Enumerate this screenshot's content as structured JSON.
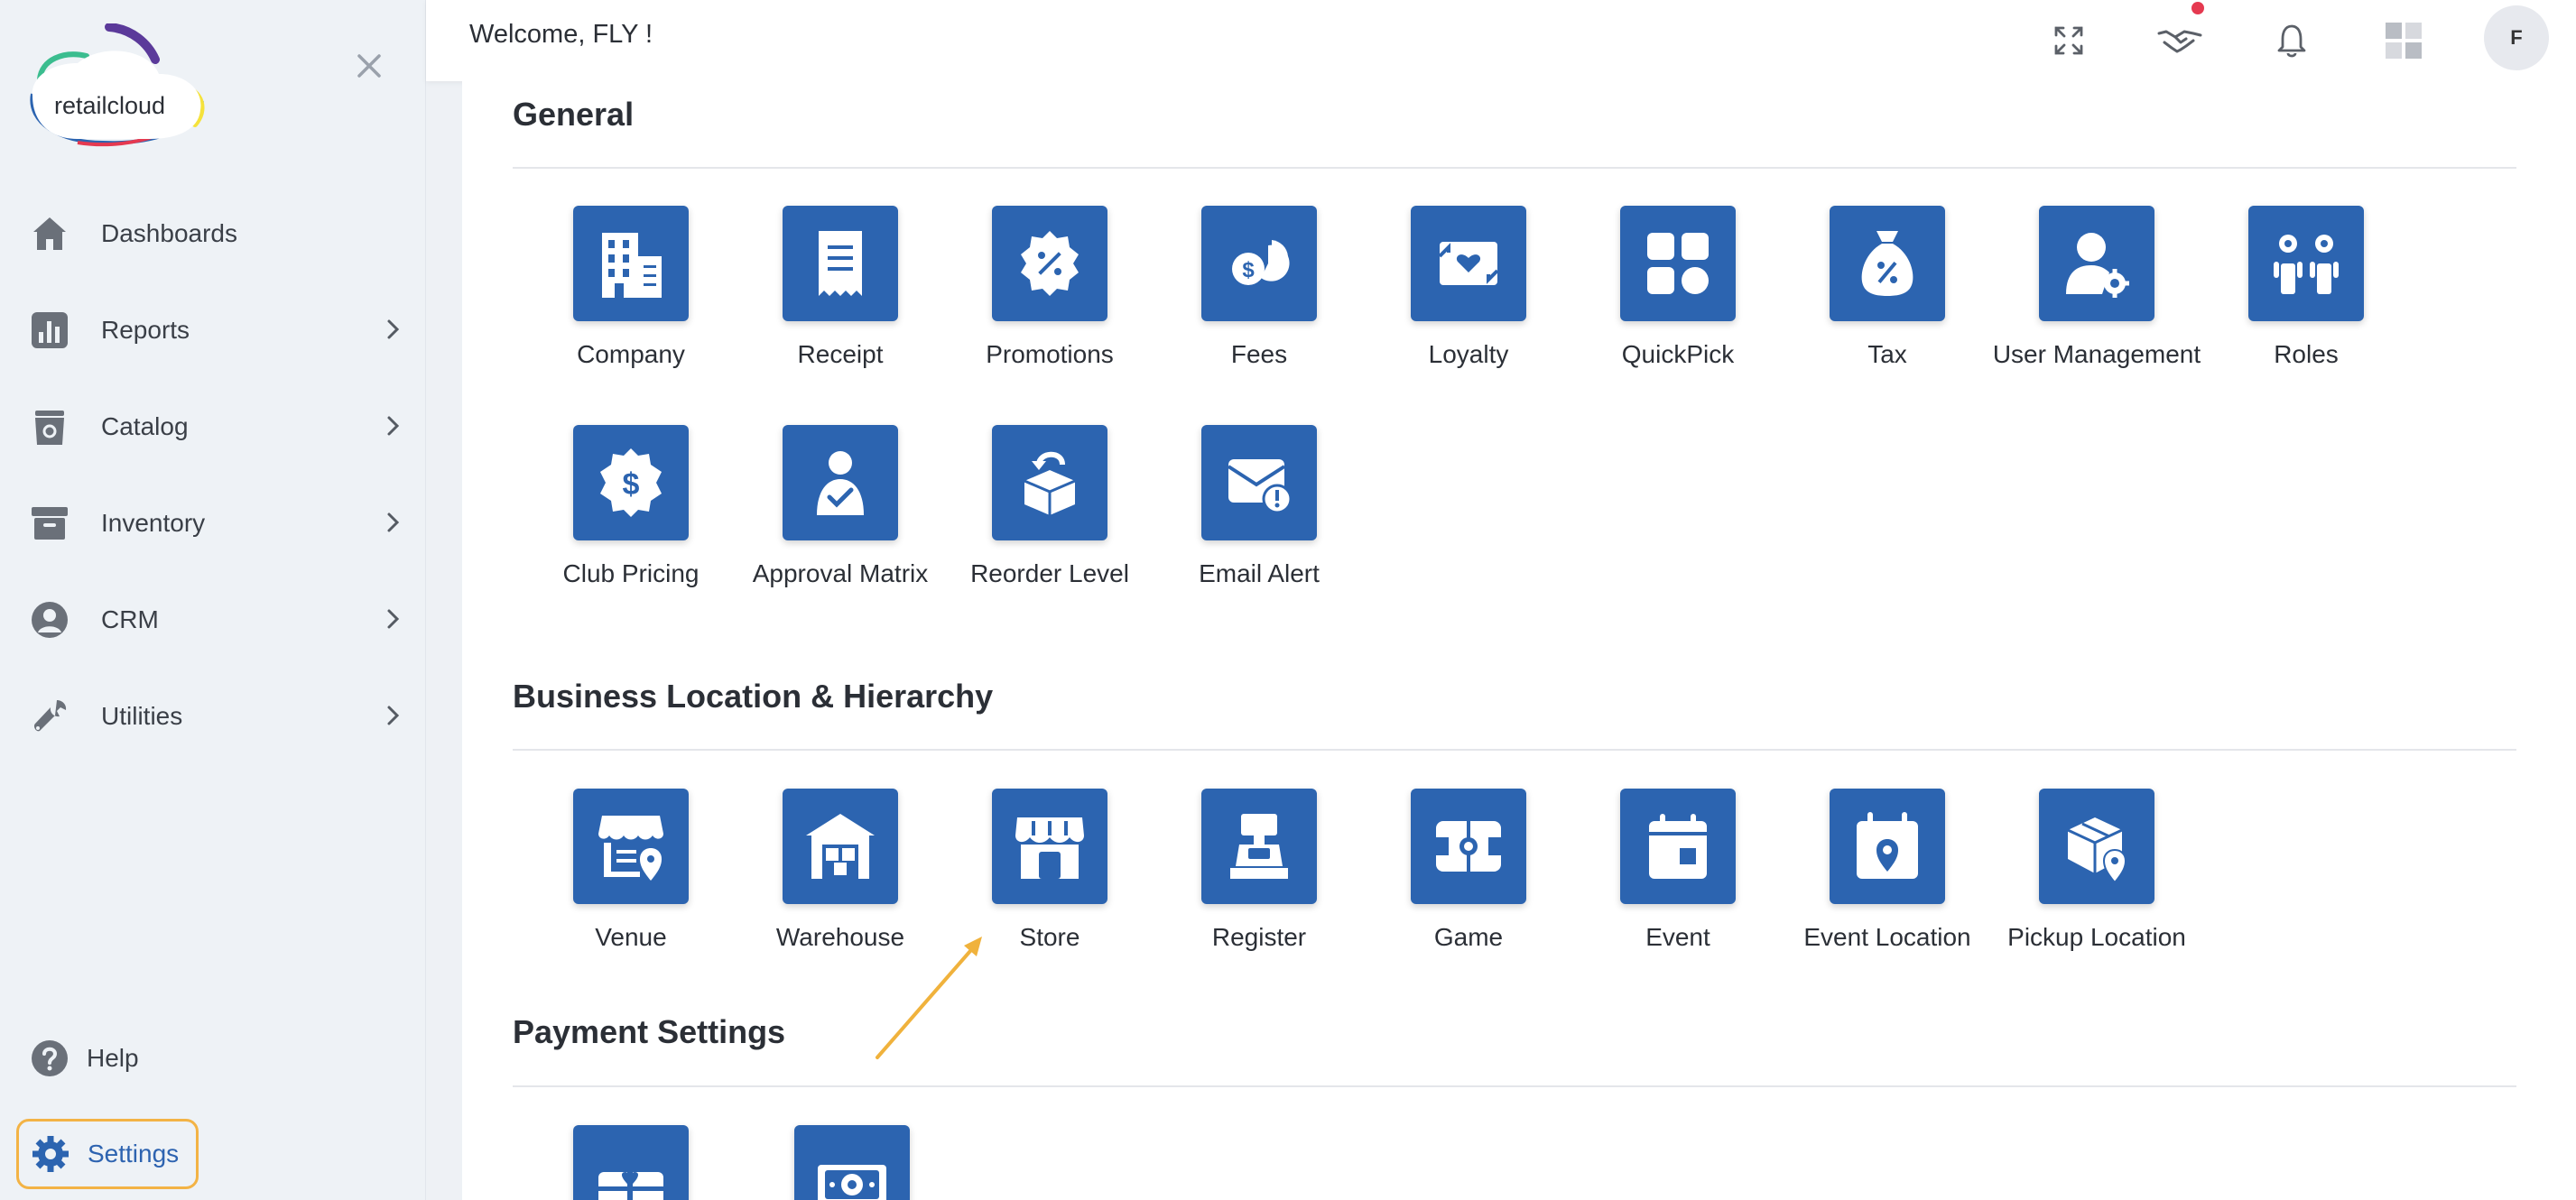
{
  "sidebar": {
    "logo_text": "retailcloud",
    "nav_items": [
      {
        "label": "Dashboards",
        "icon": "home-icon"
      },
      {
        "label": "Reports",
        "icon": "bar-chart-icon"
      },
      {
        "label": "Catalog",
        "icon": "bag-icon"
      },
      {
        "label": "Inventory",
        "icon": "archive-box-icon"
      },
      {
        "label": "CRM",
        "icon": "user-circle-icon"
      },
      {
        "label": "Utilities",
        "icon": "wrench-icon"
      }
    ],
    "help_label": "Help",
    "settings_label": "Settings"
  },
  "topbar": {
    "welcome": "Welcome, FLY !",
    "avatar_initial": "F"
  },
  "sections": {
    "general": {
      "title": "General",
      "tiles": [
        "Company",
        "Receipt",
        "Promotions",
        "Fees",
        "Loyalty",
        "QuickPick",
        "Tax",
        "User Management",
        "Roles",
        "Club Pricing",
        "Approval Matrix",
        "Reorder Level",
        "Email Alert"
      ]
    },
    "business": {
      "title": "Business Location & Hierarchy",
      "tiles": [
        "Venue",
        "Warehouse",
        "Store",
        "Register",
        "Game",
        "Event",
        "Event Location",
        "Pickup Location"
      ]
    },
    "payment": {
      "title": "Payment Settings"
    }
  },
  "colors": {
    "accent": "#2c64b0",
    "highlight": "#f3b345",
    "notification": "#e53950"
  }
}
